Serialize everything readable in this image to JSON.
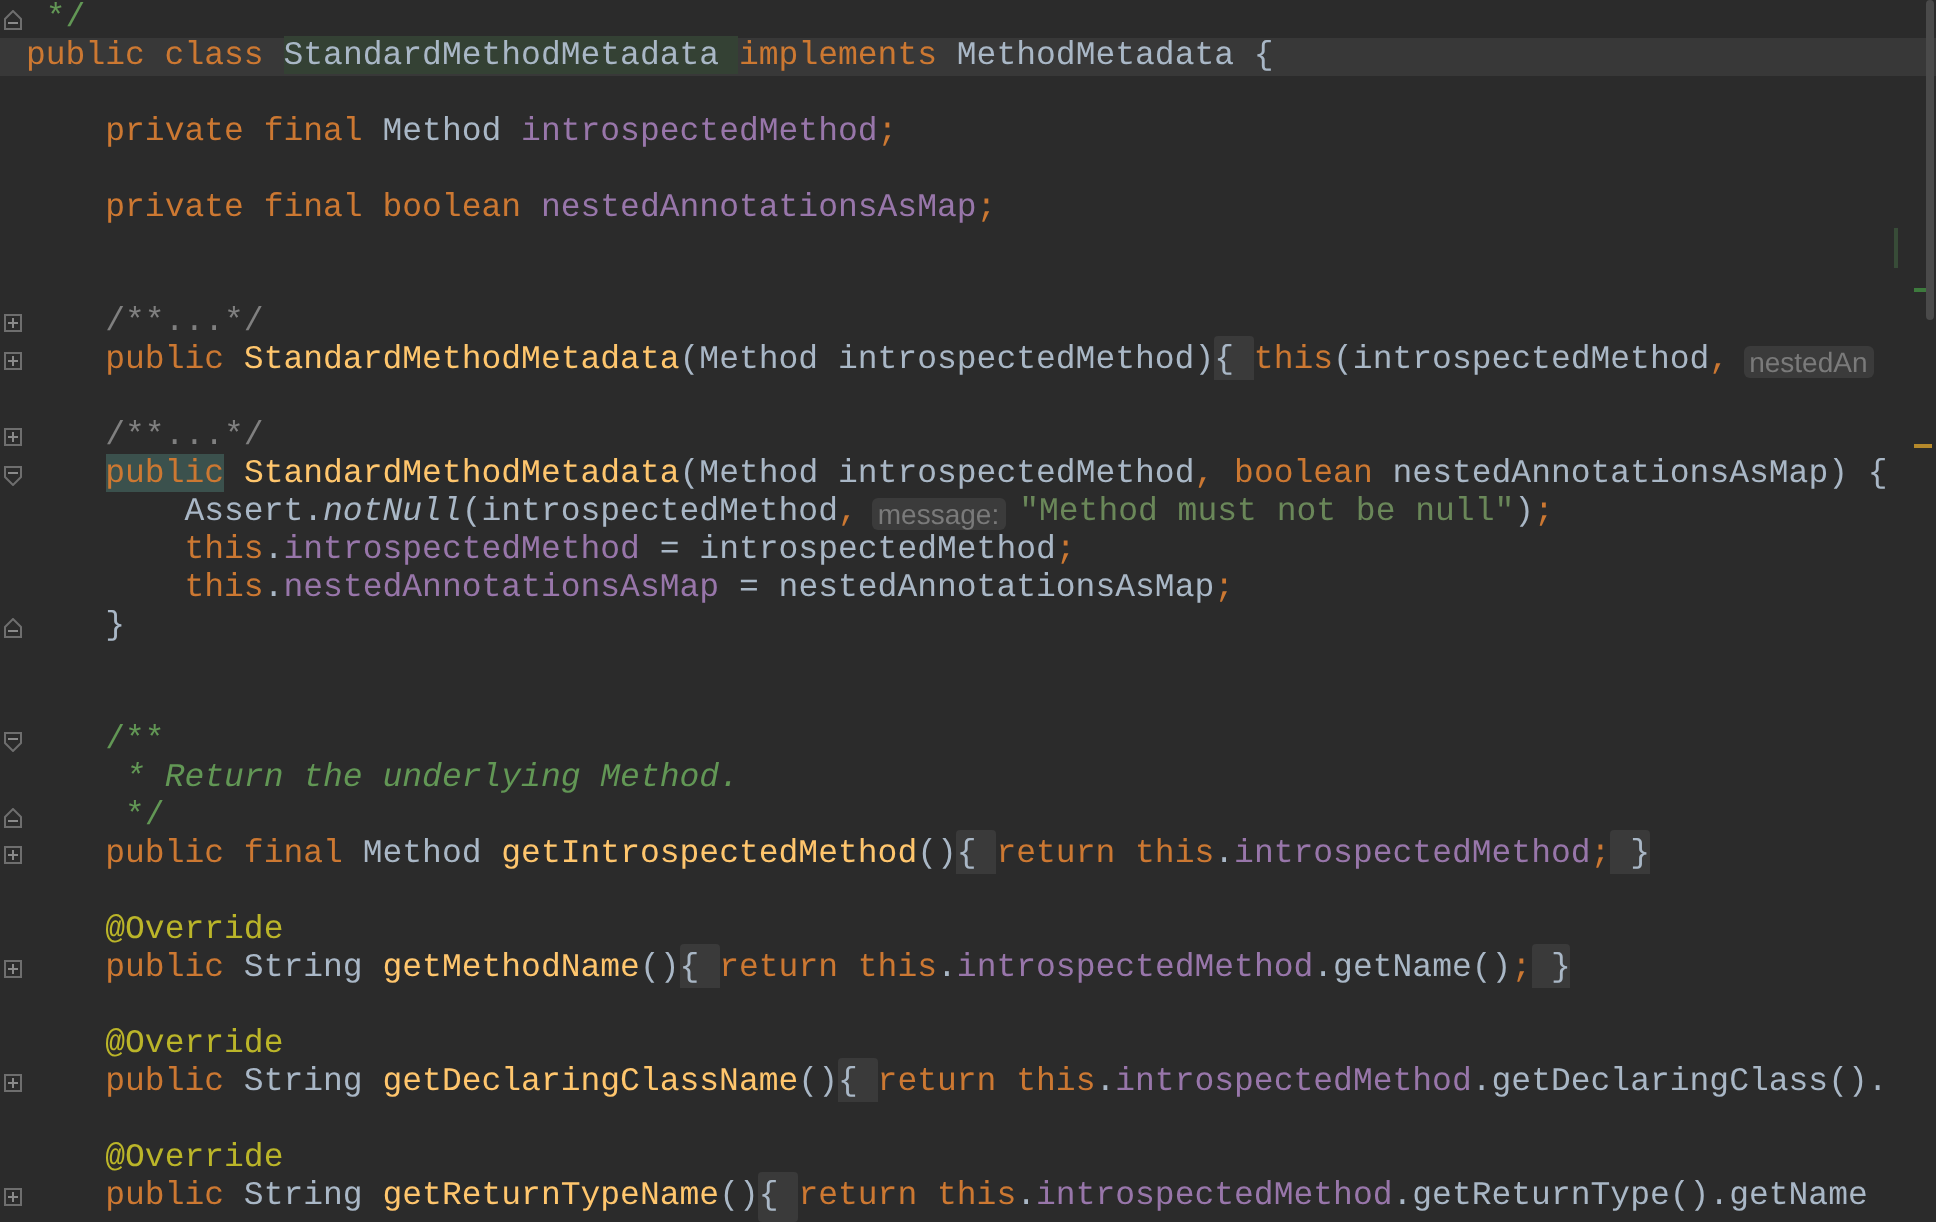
{
  "editor": {
    "lines": [
      {
        "kind": "code",
        "current": false,
        "gutter": {
          "kind": "end"
        },
        "segments": [
          {
            "kind": "code",
            "tokens": [
              {
                "text": " */",
                "kind": "doc"
              }
            ]
          }
        ]
      },
      {
        "kind": "code",
        "current": true,
        "segments": [
          {
            "kind": "code",
            "tokens": [
              {
                "text": "public class ",
                "kind": "keyword"
              },
              {
                "text": "StandardMethodMetadata ",
                "kind": "classname"
              },
              {
                "text": "implements ",
                "kind": "keyword"
              },
              {
                "text": "MethodMetadata {",
                "kind": "plain"
              }
            ]
          }
        ]
      },
      {
        "kind": "blank",
        "current": false
      },
      {
        "kind": "code",
        "current": false,
        "segments": [
          {
            "kind": "code",
            "tokens": [
              {
                "text": "    private final ",
                "kind": "keyword"
              },
              {
                "text": "Method ",
                "kind": "plain"
              },
              {
                "text": "introspectedMethod",
                "kind": "field"
              },
              {
                "text": ";",
                "kind": "keyword"
              }
            ]
          }
        ]
      },
      {
        "kind": "blank",
        "current": false
      },
      {
        "kind": "code",
        "current": false,
        "segments": [
          {
            "kind": "code",
            "tokens": [
              {
                "text": "    private final boolean ",
                "kind": "keyword"
              },
              {
                "text": "nestedAnnotationsAsMap",
                "kind": "field"
              },
              {
                "text": ";",
                "kind": "keyword"
              }
            ]
          }
        ]
      },
      {
        "kind": "blank",
        "current": false
      },
      {
        "kind": "blank",
        "current": false
      },
      {
        "kind": "code",
        "current": false,
        "gutter": {
          "kind": "expand"
        },
        "segments": [
          {
            "kind": "code",
            "tokens": [
              {
                "text": "    /**...*/",
                "kind": "comment"
              }
            ]
          }
        ]
      },
      {
        "kind": "code",
        "current": false,
        "gutter": {
          "kind": "expand"
        },
        "segments": [
          {
            "kind": "code",
            "tokens": [
              {
                "text": "    public ",
                "kind": "keyword"
              },
              {
                "text": "StandardMethodMetadata",
                "kind": "declaration"
              },
              {
                "text": "(Method introspectedMethod)",
                "kind": "plain"
              }
            ]
          },
          {
            "kind": "folded",
            "text": "{ "
          },
          {
            "kind": "code",
            "tokens": [
              {
                "text": "this",
                "kind": "keyword"
              },
              {
                "text": "(introspectedMethod",
                "kind": "plain"
              },
              {
                "text": ",",
                "kind": "keyword"
              }
            ]
          },
          {
            "kind": "hint",
            "text": "nestedAn"
          }
        ]
      },
      {
        "kind": "blank",
        "current": false
      },
      {
        "kind": "code",
        "current": false,
        "gutter": {
          "kind": "expand"
        },
        "segments": [
          {
            "kind": "code",
            "tokens": [
              {
                "text": "    /**...*/",
                "kind": "comment"
              }
            ]
          }
        ]
      },
      {
        "kind": "code",
        "current": false,
        "gutter": {
          "kind": "collapse"
        },
        "segments": [
          {
            "kind": "code",
            "tokens": [
              {
                "text": "    public",
                "kind": "marked"
              },
              {
                "text": " StandardMethodMetadata",
                "kind": "declaration"
              },
              {
                "text": "(Method introspectedMethod",
                "kind": "plain"
              },
              {
                "text": ", boolean ",
                "kind": "keyword"
              },
              {
                "text": "nestedAnnotationsAsMap) {",
                "kind": "plain"
              }
            ]
          }
        ]
      },
      {
        "kind": "code",
        "current": false,
        "segments": [
          {
            "kind": "code",
            "tokens": [
              {
                "text": "        Assert.",
                "kind": "plain"
              },
              {
                "text": "notNull",
                "kind": "static"
              },
              {
                "text": "(introspectedMethod",
                "kind": "plain"
              },
              {
                "text": ",",
                "kind": "keyword"
              }
            ]
          },
          {
            "kind": "hint",
            "text": "message:"
          },
          {
            "kind": "code",
            "tokens": [
              {
                "text": "\"Method must not be null\"",
                "kind": "string"
              },
              {
                "text": ")",
                "kind": "plain"
              },
              {
                "text": ";",
                "kind": "keyword"
              }
            ]
          }
        ]
      },
      {
        "kind": "code",
        "current": false,
        "segments": [
          {
            "kind": "code",
            "tokens": [
              {
                "text": "        this",
                "kind": "keyword"
              },
              {
                "text": ".",
                "kind": "plain"
              },
              {
                "text": "introspectedMethod",
                "kind": "field"
              },
              {
                "text": " = introspectedMethod",
                "kind": "plain"
              },
              {
                "text": ";",
                "kind": "keyword"
              }
            ]
          }
        ]
      },
      {
        "kind": "code",
        "current": false,
        "segments": [
          {
            "kind": "code",
            "tokens": [
              {
                "text": "        this",
                "kind": "keyword"
              },
              {
                "text": ".",
                "kind": "plain"
              },
              {
                "text": "nestedAnnotationsAsMap",
                "kind": "field"
              },
              {
                "text": " = nestedAnnotationsAsMap",
                "kind": "plain"
              },
              {
                "text": ";",
                "kind": "keyword"
              }
            ]
          }
        ]
      },
      {
        "kind": "code",
        "current": false,
        "gutter": {
          "kind": "end"
        },
        "segments": [
          {
            "kind": "code",
            "tokens": [
              {
                "text": "    }",
                "kind": "plain"
              }
            ]
          }
        ]
      },
      {
        "kind": "blank",
        "current": false
      },
      {
        "kind": "blank",
        "current": false
      },
      {
        "kind": "code",
        "current": false,
        "gutter": {
          "kind": "collapse"
        },
        "segments": [
          {
            "kind": "code",
            "tokens": [
              {
                "text": "    /**",
                "kind": "doc"
              }
            ]
          }
        ]
      },
      {
        "kind": "code",
        "current": false,
        "segments": [
          {
            "kind": "code",
            "tokens": [
              {
                "text": "     * Return the underlying Method.",
                "kind": "doctext"
              }
            ]
          }
        ]
      },
      {
        "kind": "code",
        "current": false,
        "gutter": {
          "kind": "end"
        },
        "segments": [
          {
            "kind": "code",
            "tokens": [
              {
                "text": "     */",
                "kind": "doc"
              }
            ]
          }
        ]
      },
      {
        "kind": "code",
        "current": false,
        "gutter": {
          "kind": "expand"
        },
        "segments": [
          {
            "kind": "code",
            "tokens": [
              {
                "text": "    public final ",
                "kind": "keyword"
              },
              {
                "text": "Method ",
                "kind": "plain"
              },
              {
                "text": "getIntrospectedMethod",
                "kind": "declaration"
              },
              {
                "text": "()",
                "kind": "plain"
              }
            ]
          },
          {
            "kind": "folded",
            "text": "{ "
          },
          {
            "kind": "code",
            "tokens": [
              {
                "text": "return this",
                "kind": "keyword"
              },
              {
                "text": ".",
                "kind": "plain"
              },
              {
                "text": "introspectedMethod",
                "kind": "field"
              },
              {
                "text": ";",
                "kind": "keyword"
              }
            ]
          },
          {
            "kind": "folded",
            "text": " }"
          }
        ]
      },
      {
        "kind": "blank",
        "current": false
      },
      {
        "kind": "code",
        "current": false,
        "segments": [
          {
            "kind": "code",
            "tokens": [
              {
                "text": "    @Override",
                "kind": "annotation"
              }
            ]
          }
        ]
      },
      {
        "kind": "code",
        "current": false,
        "gutter": {
          "kind": "expand"
        },
        "segments": [
          {
            "kind": "code",
            "tokens": [
              {
                "text": "    public ",
                "kind": "keyword"
              },
              {
                "text": "String ",
                "kind": "plain"
              },
              {
                "text": "getMethodName",
                "kind": "declaration"
              },
              {
                "text": "()",
                "kind": "plain"
              }
            ]
          },
          {
            "kind": "folded",
            "text": "{ "
          },
          {
            "kind": "code",
            "tokens": [
              {
                "text": "return this",
                "kind": "keyword"
              },
              {
                "text": ".",
                "kind": "plain"
              },
              {
                "text": "introspectedMethod",
                "kind": "field"
              },
              {
                "text": ".getName()",
                "kind": "plain"
              },
              {
                "text": ";",
                "kind": "keyword"
              }
            ]
          },
          {
            "kind": "folded",
            "text": " }"
          }
        ]
      },
      {
        "kind": "blank",
        "current": false
      },
      {
        "kind": "code",
        "current": false,
        "segments": [
          {
            "kind": "code",
            "tokens": [
              {
                "text": "    @Override",
                "kind": "annotation"
              }
            ]
          }
        ]
      },
      {
        "kind": "code",
        "current": false,
        "gutter": {
          "kind": "expand"
        },
        "segments": [
          {
            "kind": "code",
            "tokens": [
              {
                "text": "    public ",
                "kind": "keyword"
              },
              {
                "text": "String ",
                "kind": "plain"
              },
              {
                "text": "getDeclaringClassName",
                "kind": "declaration"
              },
              {
                "text": "()",
                "kind": "plain"
              }
            ]
          },
          {
            "kind": "folded",
            "text": "{ "
          },
          {
            "kind": "code",
            "tokens": [
              {
                "text": "return this",
                "kind": "keyword"
              },
              {
                "text": ".",
                "kind": "plain"
              },
              {
                "text": "introspectedMethod",
                "kind": "field"
              },
              {
                "text": ".getDeclaringClass().",
                "kind": "plain"
              }
            ]
          }
        ]
      },
      {
        "kind": "blank",
        "current": false
      },
      {
        "kind": "code",
        "current": false,
        "segments": [
          {
            "kind": "code",
            "tokens": [
              {
                "text": "    @Override",
                "kind": "annotation"
              }
            ]
          }
        ]
      },
      {
        "kind": "code",
        "current": false,
        "gutter": {
          "kind": "expand"
        },
        "segments": [
          {
            "kind": "code",
            "tokens": [
              {
                "text": "    public ",
                "kind": "keyword"
              },
              {
                "text": "String ",
                "kind": "plain"
              },
              {
                "text": "getReturnTypeName",
                "kind": "declaration"
              },
              {
                "text": "()",
                "kind": "plain"
              }
            ]
          },
          {
            "kind": "folded",
            "text": "{ "
          },
          {
            "kind": "code",
            "tokens": [
              {
                "text": "return this",
                "kind": "keyword"
              },
              {
                "text": ".",
                "kind": "plain"
              },
              {
                "text": "introspectedMethod",
                "kind": "field"
              },
              {
                "text": ".getReturnType().getName",
                "kind": "plain"
              }
            ]
          }
        ]
      }
    ]
  }
}
